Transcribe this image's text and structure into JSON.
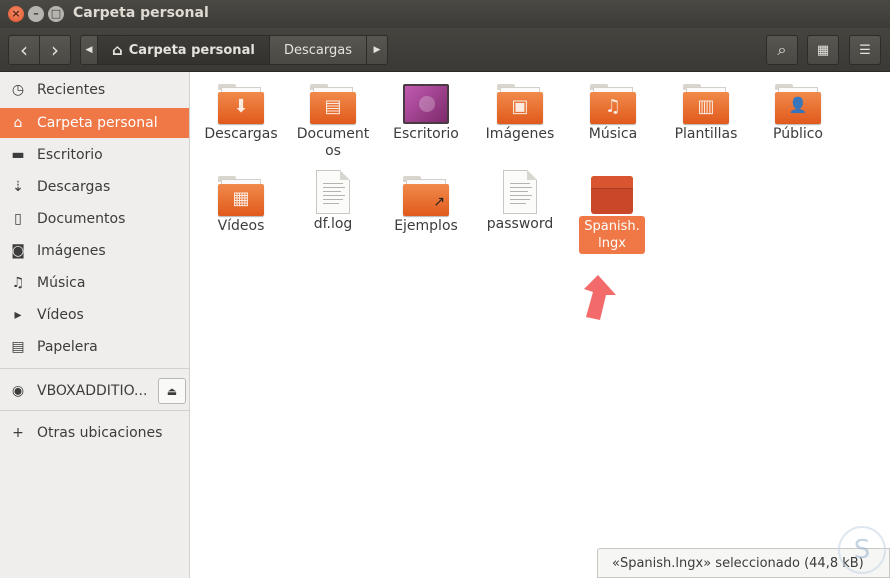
{
  "window": {
    "title": "Carpeta personal",
    "controls": {
      "close": "×",
      "minimize": "–",
      "maximize": "□"
    }
  },
  "header": {
    "back_icon": "‹",
    "forward_icon": "›",
    "path_left_icon": "◀",
    "path_right_icon": "▶",
    "home_icon": "⌂",
    "breadcrumb": [
      "Carpeta personal",
      "Descargas"
    ],
    "search_icon": "⌕",
    "grid_icon": "▦",
    "menu_icon": "☰"
  },
  "sidebar": {
    "items": [
      {
        "label": "Recientes",
        "icon": "◷"
      },
      {
        "label": "Carpeta personal",
        "icon": "⌂"
      },
      {
        "label": "Escritorio",
        "icon": "▬"
      },
      {
        "label": "Descargas",
        "icon": "⇣"
      },
      {
        "label": "Documentos",
        "icon": "▯"
      },
      {
        "label": "Imágenes",
        "icon": "◙"
      },
      {
        "label": "Música",
        "icon": "♫"
      },
      {
        "label": "Vídeos",
        "icon": "▸"
      },
      {
        "label": "Papelera",
        "icon": "▤"
      }
    ],
    "device": {
      "label": "VBOXADDITIO...",
      "icon": "◉",
      "eject_icon": "⏏"
    },
    "other": {
      "label": "Otras ubicaciones",
      "icon": "+"
    }
  },
  "files": [
    {
      "label": "Descargas",
      "kind": "folder",
      "emblem": "⬇"
    },
    {
      "label": "Documentos",
      "kind": "folder",
      "emblem": "▤"
    },
    {
      "label": "Escritorio",
      "kind": "desktop",
      "emblem": ""
    },
    {
      "label": "Imágenes",
      "kind": "folder",
      "emblem": "▣"
    },
    {
      "label": "Música",
      "kind": "folder",
      "emblem": "♫"
    },
    {
      "label": "Plantillas",
      "kind": "folder",
      "emblem": "▥"
    },
    {
      "label": "Público",
      "kind": "folder",
      "emblem": "👤"
    },
    {
      "label": "Vídeos",
      "kind": "folder",
      "emblem": "▦"
    },
    {
      "label": "df.log",
      "kind": "document",
      "emblem": ""
    },
    {
      "label": "Ejemplos",
      "kind": "folder",
      "emblem": "↗"
    },
    {
      "label": "password",
      "kind": "document",
      "emblem": ""
    },
    {
      "label": "Spanish.lngx",
      "kind": "package",
      "emblem": ""
    }
  ],
  "status": {
    "text": "«Spanish.lngx» seleccionado  (44,8 kB)"
  },
  "colors": {
    "accent": "#f07746",
    "titlebar": "#3c3b37",
    "folder": "#e8692e",
    "arrow": "#f26a6a"
  },
  "watermark_icon": "S"
}
